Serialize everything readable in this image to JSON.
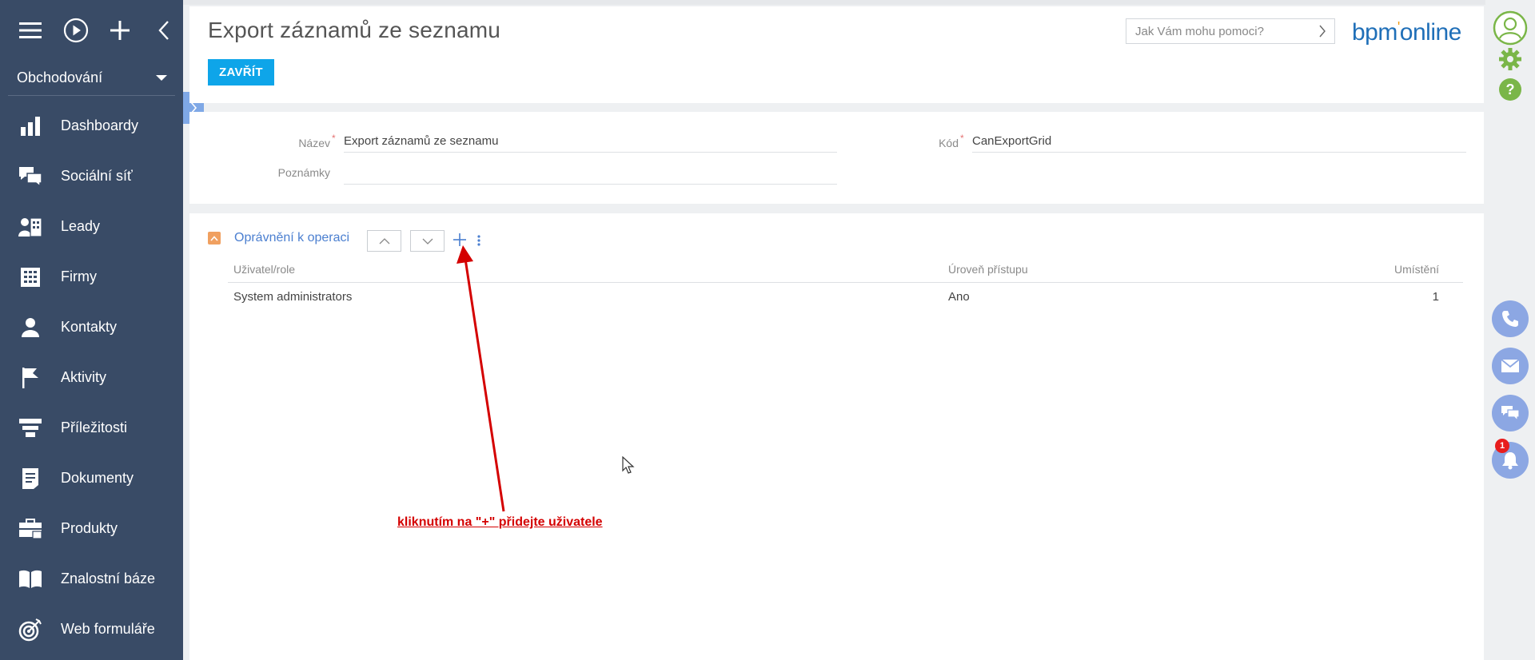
{
  "sidebar": {
    "section": "Obchodování",
    "items": [
      {
        "label": "Dashboardy",
        "icon": "bar-chart-icon"
      },
      {
        "label": "Sociální síť",
        "icon": "chat-bubbles-icon"
      },
      {
        "label": "Leady",
        "icon": "leads-icon"
      },
      {
        "label": "Firmy",
        "icon": "building-icon"
      },
      {
        "label": "Kontakty",
        "icon": "person-icon"
      },
      {
        "label": "Aktivity",
        "icon": "flag-icon"
      },
      {
        "label": "Příležitosti",
        "icon": "funnel-icon"
      },
      {
        "label": "Dokumenty",
        "icon": "document-icon"
      },
      {
        "label": "Produkty",
        "icon": "briefcase-icon"
      },
      {
        "label": "Znalostní báze",
        "icon": "book-icon"
      },
      {
        "label": "Web formuláře",
        "icon": "target-icon"
      }
    ]
  },
  "header": {
    "title": "Export záznamů ze seznamu",
    "close_label": "ZAVŘÍT",
    "help_placeholder": "Jak Vám mohu pomoci?",
    "logo_text": "bpm",
    "logo_text2": "online"
  },
  "form": {
    "name_label": "Název",
    "name_value": "Export záznamů ze seznamu",
    "notes_label": "Poznámky",
    "notes_value": "",
    "code_label": "Kód",
    "code_value": "CanExportGrid"
  },
  "detail": {
    "title": "Oprávnění k operaci",
    "columns": [
      "Uživatel/role",
      "Úroveň přístupu",
      "Umístění"
    ],
    "rows": [
      {
        "user": "System administrators",
        "level": "Ano",
        "position": "1"
      }
    ]
  },
  "annotation": "kliknutím na \"+\" přidejte uživatele",
  "rail": {
    "notification_count": "1"
  },
  "colors": {
    "sidebar": "#394b66",
    "accent": "#0ea5e9",
    "link": "#4b7fd0",
    "annotation": "#d40000"
  }
}
